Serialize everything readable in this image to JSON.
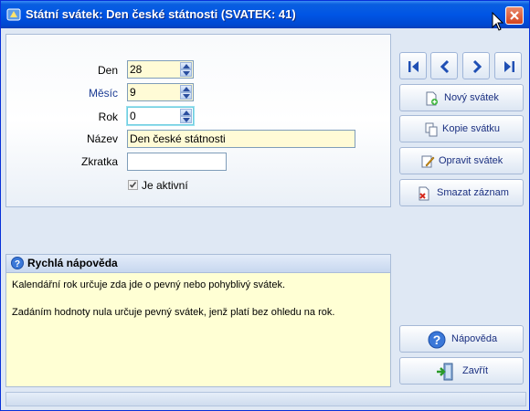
{
  "window": {
    "title": "Státní svátek: Den české státnosti (SVATEK: 41)"
  },
  "form": {
    "den": {
      "label": "Den",
      "value": "28"
    },
    "mesic": {
      "label": "Měsíc",
      "value": "9"
    },
    "rok": {
      "label": "Rok",
      "value": "0"
    },
    "nazev": {
      "label": "Název",
      "value": "Den české státnosti"
    },
    "zkratka": {
      "label": "Zkratka",
      "value": ""
    },
    "aktivni": {
      "label": "Je aktivní",
      "checked": true
    }
  },
  "help": {
    "title": "Rychlá nápověda",
    "lines": [
      "Kalendářní rok určuje zda jde o pevný nebo pohyblivý svátek.",
      "Zadáním hodnoty nula určuje pevný svátek, jenž platí bez ohledu na rok."
    ]
  },
  "buttons": {
    "novy": "Nový svátek",
    "kopie": "Kopie svátku",
    "opravit": "Opravit svátek",
    "smazat": "Smazat záznam",
    "napoveda": "Nápověda",
    "zavrit": "Zavřít"
  },
  "colors": {
    "title_bar": "#0055e5",
    "input_bg": "#fffbd6",
    "help_bg": "#ffffd4",
    "accent_label": "#1c3c94"
  }
}
